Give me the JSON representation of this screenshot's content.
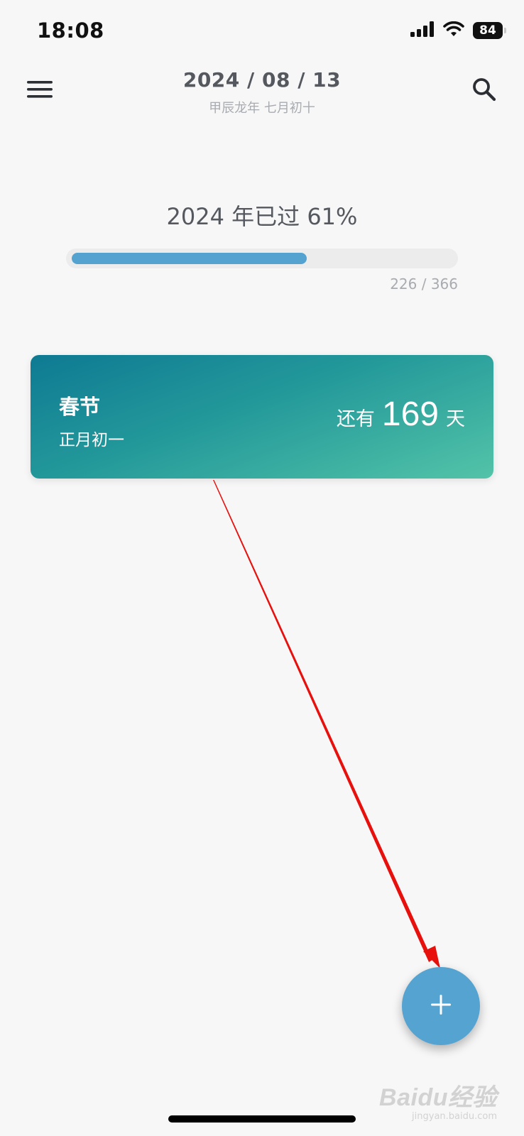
{
  "status_bar": {
    "time": "18:08",
    "battery": "84",
    "signal_icon": "cellular-signal-icon",
    "wifi_icon": "wifi-icon"
  },
  "header": {
    "date": "2024 / 08 / 13",
    "lunar_date": "甲辰龙年 七月初十",
    "menu_icon": "hamburger-menu-icon",
    "search_icon": "search-icon"
  },
  "year_progress": {
    "title": "2024 年已过 61%",
    "count": "226 / 366",
    "fraction": 0.617,
    "fill_color": "#54a2d0"
  },
  "event_card": {
    "name": "春节",
    "lunar": "正月初一",
    "countdown_prefix": "还有",
    "countdown_days": "169",
    "countdown_suffix": "天",
    "gradient_colors": [
      "#0e7a93",
      "#53c3a8"
    ]
  },
  "fab": {
    "icon": "plus-icon",
    "color": "#55a3d1"
  },
  "watermark": {
    "logo": "Baidu经验",
    "url": "jingyan.baidu.com"
  },
  "annotation": {
    "color": "#e8100c"
  }
}
